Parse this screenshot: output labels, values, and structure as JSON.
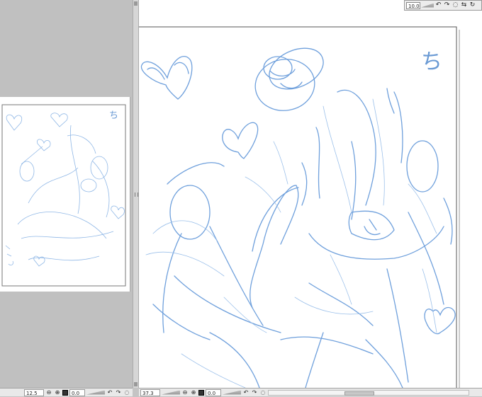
{
  "left_pane": {
    "zoom": "12.5",
    "angle": "0.0",
    "canvas_mark": "ち"
  },
  "right_pane": {
    "zoom": "37.3",
    "angle": "0.0",
    "canvas_mark": "ち"
  },
  "navigator": {
    "value": "10.0"
  },
  "icons": {
    "zoom_out": "zoom-out-icon",
    "zoom_in": "zoom-in-icon",
    "fit": "fit-window-icon",
    "rotate_left": "rotate-left-icon",
    "rotate_right": "rotate-right-icon",
    "rotate_reset": "rotate-reset-icon",
    "flip": "flip-horizontal-icon"
  },
  "colors": {
    "sketch_stroke": "#6fa0dc",
    "panel_bg": "#c4c4c4",
    "canvas_bg": "#ffffff"
  }
}
